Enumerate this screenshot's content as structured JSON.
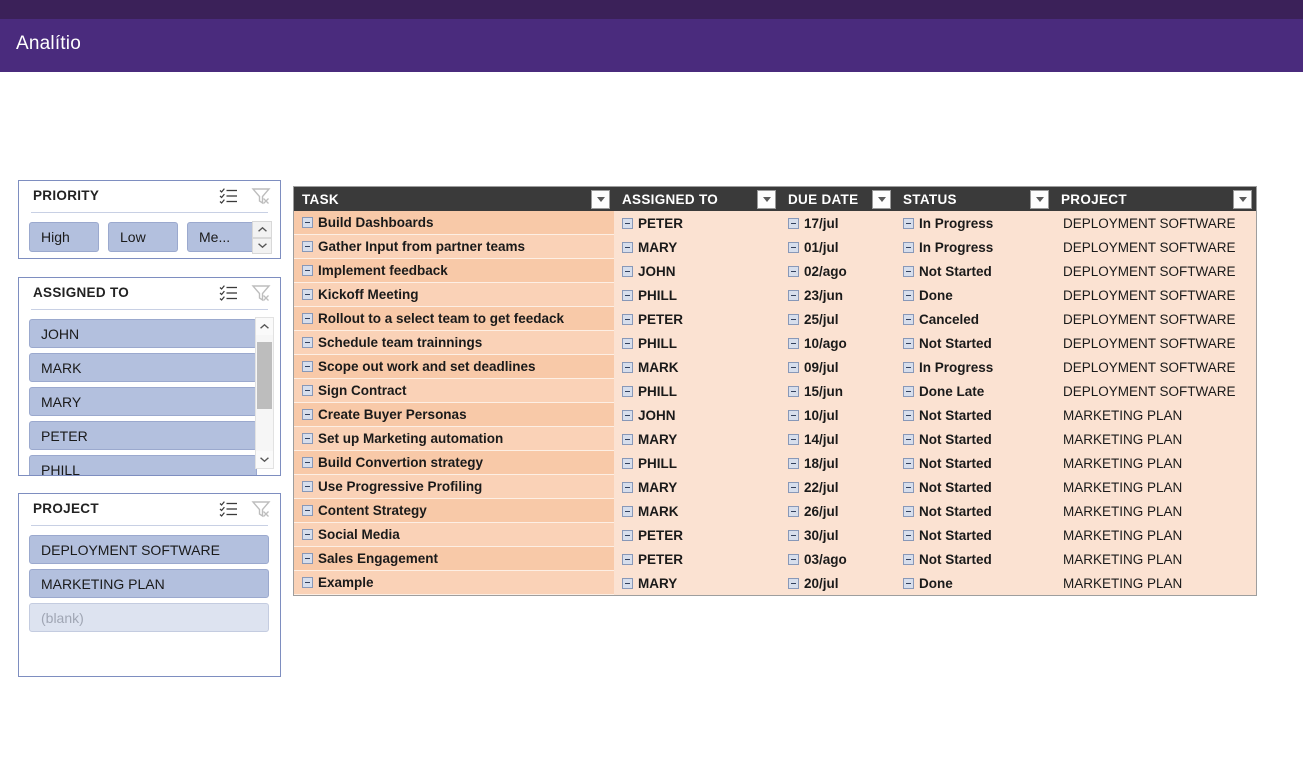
{
  "app": {
    "title": "Analítio",
    "banner_dark": "#3B2159",
    "banner_main": "#4A2B7D"
  },
  "slicers": [
    {
      "id": "priority",
      "title": "PRIORITY",
      "multiselect_icon": "multi-select-icon",
      "clear_filter_icon": "clear-filter-icon",
      "items": [
        {
          "label": "High",
          "state": "selected"
        },
        {
          "label": "Low",
          "state": "selected"
        },
        {
          "label": "Me...",
          "state": "selected"
        }
      ],
      "has_spinner": true
    },
    {
      "id": "assigned",
      "title": "ASSIGNED TO",
      "multiselect_icon": "multi-select-icon",
      "clear_filter_icon": "clear-filter-icon",
      "items": [
        {
          "label": "JOHN",
          "state": "selected"
        },
        {
          "label": "MARK",
          "state": "selected"
        },
        {
          "label": "MARY",
          "state": "selected"
        },
        {
          "label": "PETER",
          "state": "selected"
        },
        {
          "label": "PHILL",
          "state": "selected"
        }
      ],
      "has_scrollbar": true
    },
    {
      "id": "project",
      "title": "PROJECT",
      "multiselect_icon": "multi-select-icon",
      "clear_filter_icon": "clear-filter-icon",
      "items": [
        {
          "label": "DEPLOYMENT SOFTWARE",
          "state": "selected"
        },
        {
          "label": "MARKETING PLAN",
          "state": "selected"
        },
        {
          "label": "(blank)",
          "state": "blank"
        }
      ]
    }
  ],
  "table": {
    "columns": [
      {
        "label": "TASK",
        "key": "task",
        "filter": true
      },
      {
        "label": "ASSIGNED TO",
        "key": "assigned",
        "filter": true
      },
      {
        "label": "DUE DATE",
        "key": "due",
        "filter": true
      },
      {
        "label": "STATUS",
        "key": "status",
        "filter": true
      },
      {
        "label": "PROJECT",
        "key": "project",
        "filter": true
      }
    ],
    "rows": [
      {
        "task": "Build Dashboards",
        "assigned": "PETER",
        "due": "17/jul",
        "status": "In Progress",
        "project": "DEPLOYMENT SOFTWARE"
      },
      {
        "task": "Gather Input from partner teams",
        "assigned": "MARY",
        "due": "01/jul",
        "status": "In Progress",
        "project": "DEPLOYMENT SOFTWARE"
      },
      {
        "task": "Implement feedback",
        "assigned": "JOHN",
        "due": "02/ago",
        "status": "Not Started",
        "project": "DEPLOYMENT SOFTWARE"
      },
      {
        "task": "Kickoff Meeting",
        "assigned": "PHILL",
        "due": "23/jun",
        "status": "Done",
        "project": "DEPLOYMENT SOFTWARE"
      },
      {
        "task": "Rollout to a select team to get feedack",
        "assigned": "PETER",
        "due": "25/jul",
        "status": "Canceled",
        "project": "DEPLOYMENT SOFTWARE"
      },
      {
        "task": "Schedule team trainnings",
        "assigned": "PHILL",
        "due": "10/ago",
        "status": "Not Started",
        "project": "DEPLOYMENT SOFTWARE"
      },
      {
        "task": "Scope out work and set deadlines",
        "assigned": "MARK",
        "due": "09/jul",
        "status": "In Progress",
        "project": "DEPLOYMENT SOFTWARE"
      },
      {
        "task": "Sign Contract",
        "assigned": "PHILL",
        "due": "15/jun",
        "status": "Done Late",
        "project": "DEPLOYMENT SOFTWARE"
      },
      {
        "task": "Create Buyer Personas",
        "assigned": "JOHN",
        "due": "10/jul",
        "status": "Not Started",
        "project": "MARKETING PLAN"
      },
      {
        "task": "Set up Marketing automation",
        "assigned": "MARY",
        "due": "14/jul",
        "status": "Not Started",
        "project": "MARKETING PLAN"
      },
      {
        "task": "Build Convertion strategy",
        "assigned": "PHILL",
        "due": "18/jul",
        "status": "Not Started",
        "project": "MARKETING PLAN"
      },
      {
        "task": "Use Progressive Profiling",
        "assigned": "MARY",
        "due": "22/jul",
        "status": "Not Started",
        "project": "MARKETING PLAN"
      },
      {
        "task": "Content Strategy",
        "assigned": "MARK",
        "due": "26/jul",
        "status": "Not Started",
        "project": "MARKETING PLAN"
      },
      {
        "task": "Social Media",
        "assigned": "PETER",
        "due": "30/jul",
        "status": "Not Started",
        "project": "MARKETING PLAN"
      },
      {
        "task": "Sales Engagement",
        "assigned": "PETER",
        "due": "03/ago",
        "status": "Not Started",
        "project": "MARKETING PLAN"
      },
      {
        "task": "Example",
        "assigned": "MARY",
        "due": "20/jul",
        "status": "Done",
        "project": "MARKETING PLAN"
      }
    ]
  },
  "colors": {
    "header_bg": "#3A3A3A",
    "task_col_bg": "#F8C9A8",
    "data_bg": "#FBE2D2",
    "slicer_item_bg": "#B3C0DE",
    "slicer_border": "#7E8EC0"
  }
}
